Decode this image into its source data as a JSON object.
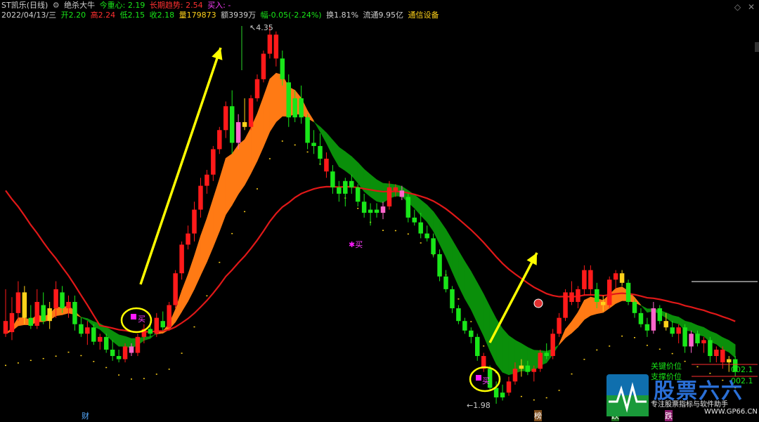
{
  "header": {
    "stock_name": "ST凯乐(日线)",
    "indicator_name": "绝杀大牛",
    "today_center_label": "今重心:",
    "today_center_value": "2.19",
    "long_trend_label": "长期趋势:",
    "long_trend_value": "2.54",
    "buy_in_label": "买入:",
    "buy_in_value": "-",
    "date": "2022/04/13/三",
    "open_label": "开",
    "open": "2.20",
    "high_label": "高",
    "high": "2.24",
    "low_label": "低",
    "low": "2.15",
    "close_label": "收",
    "close": "2.18",
    "volume_label": "量",
    "volume": "179873",
    "amount_label": "额",
    "amount": "3939万",
    "change_label": "幅",
    "change": "-0.05(-2.24%)",
    "turnover_label": "换",
    "turnover": "1.81%",
    "float_label": "流通",
    "float_cap": "9.95亿",
    "sector": "通信设备"
  },
  "icons": {
    "settings": "gear-icon",
    "expand": "diamond-icon",
    "close": "close-icon"
  },
  "annotations": {
    "high_price": "4.35",
    "low_price": "1.98",
    "buy_label": "买",
    "key_price_label": "关键价位",
    "support_label": "支撑价位",
    "key_price_value": "002.1",
    "support_value": "002.1",
    "bottom_markers": [
      "财",
      "榜",
      "跌",
      "跌"
    ]
  },
  "logo": {
    "title": "股票六六",
    "subtitle": "专注股票指标与软件助手",
    "site": "WWW.GP66.CN"
  },
  "colors": {
    "up": "#ff1a1a",
    "down": "#19e619",
    "yellow": "#ffd21a",
    "pink": "#ff66cc",
    "green_band": "#0a8f0a",
    "orange_band": "#ff7a14",
    "ma_red": "#e01818",
    "arrow": "#ffff00",
    "circle": "#ffff00",
    "buy_marker": "#ff1aff"
  },
  "chart_data": {
    "type": "candlestick",
    "price_range": [
      1.98,
      4.35
    ],
    "candles": [
      {
        "o": 2.5,
        "h": 2.7,
        "l": 2.4,
        "c": 2.42,
        "col": "up"
      },
      {
        "o": 2.43,
        "h": 2.65,
        "l": 2.38,
        "c": 2.55,
        "col": "up"
      },
      {
        "o": 2.55,
        "h": 2.75,
        "l": 2.5,
        "c": 2.68,
        "col": "up"
      },
      {
        "o": 2.68,
        "h": 2.72,
        "l": 2.48,
        "c": 2.52,
        "col": "yellow"
      },
      {
        "o": 2.52,
        "h": 2.6,
        "l": 2.45,
        "c": 2.47,
        "col": "down"
      },
      {
        "o": 2.47,
        "h": 2.7,
        "l": 2.45,
        "c": 2.62,
        "col": "up"
      },
      {
        "o": 2.6,
        "h": 2.68,
        "l": 2.48,
        "c": 2.5,
        "col": "down"
      },
      {
        "o": 2.5,
        "h": 2.62,
        "l": 2.45,
        "c": 2.58,
        "col": "yellow"
      },
      {
        "o": 2.58,
        "h": 2.75,
        "l": 2.52,
        "c": 2.7,
        "col": "up"
      },
      {
        "o": 2.68,
        "h": 2.72,
        "l": 2.55,
        "c": 2.58,
        "col": "down"
      },
      {
        "o": 2.58,
        "h": 2.66,
        "l": 2.52,
        "c": 2.62,
        "col": "up"
      },
      {
        "o": 2.62,
        "h": 2.66,
        "l": 2.44,
        "c": 2.48,
        "col": "down"
      },
      {
        "o": 2.48,
        "h": 2.52,
        "l": 2.4,
        "c": 2.42,
        "col": "down"
      },
      {
        "o": 2.42,
        "h": 2.5,
        "l": 2.35,
        "c": 2.46,
        "col": "up"
      },
      {
        "o": 2.46,
        "h": 2.48,
        "l": 2.35,
        "c": 2.37,
        "col": "down"
      },
      {
        "o": 2.37,
        "h": 2.42,
        "l": 2.32,
        "c": 2.4,
        "col": "up"
      },
      {
        "o": 2.4,
        "h": 2.42,
        "l": 2.3,
        "c": 2.32,
        "col": "down"
      },
      {
        "o": 2.32,
        "h": 2.38,
        "l": 2.25,
        "c": 2.28,
        "col": "down"
      },
      {
        "o": 2.28,
        "h": 2.32,
        "l": 2.24,
        "c": 2.26,
        "col": "down"
      },
      {
        "o": 2.26,
        "h": 2.36,
        "l": 2.24,
        "c": 2.34,
        "col": "up"
      },
      {
        "o": 2.34,
        "h": 2.36,
        "l": 2.28,
        "c": 2.3,
        "col": "pink"
      },
      {
        "o": 2.3,
        "h": 2.42,
        "l": 2.28,
        "c": 2.4,
        "col": "up"
      },
      {
        "o": 2.4,
        "h": 2.48,
        "l": 2.36,
        "c": 2.45,
        "col": "up"
      },
      {
        "o": 2.45,
        "h": 2.5,
        "l": 2.4,
        "c": 2.42,
        "col": "down"
      },
      {
        "o": 2.42,
        "h": 2.55,
        "l": 2.4,
        "c": 2.52,
        "col": "up"
      },
      {
        "o": 2.5,
        "h": 2.56,
        "l": 2.44,
        "c": 2.46,
        "col": "down"
      },
      {
        "o": 2.46,
        "h": 2.62,
        "l": 2.44,
        "c": 2.6,
        "col": "up"
      },
      {
        "o": 2.6,
        "h": 2.82,
        "l": 2.58,
        "c": 2.8,
        "col": "up"
      },
      {
        "o": 2.8,
        "h": 3.0,
        "l": 2.76,
        "c": 2.98,
        "col": "up"
      },
      {
        "o": 2.98,
        "h": 3.1,
        "l": 2.95,
        "c": 3.05,
        "col": "up"
      },
      {
        "o": 3.05,
        "h": 3.25,
        "l": 3.0,
        "c": 3.2,
        "col": "up"
      },
      {
        "o": 3.2,
        "h": 3.4,
        "l": 3.15,
        "c": 3.35,
        "col": "up"
      },
      {
        "o": 3.35,
        "h": 3.45,
        "l": 3.3,
        "c": 3.42,
        "col": "up"
      },
      {
        "o": 3.42,
        "h": 3.6,
        "l": 3.38,
        "c": 3.58,
        "col": "up"
      },
      {
        "o": 3.58,
        "h": 3.72,
        "l": 3.55,
        "c": 3.7,
        "col": "up"
      },
      {
        "o": 3.7,
        "h": 3.88,
        "l": 3.65,
        "c": 3.85,
        "col": "up"
      },
      {
        "o": 3.85,
        "h": 3.95,
        "l": 3.55,
        "c": 3.62,
        "col": "down"
      },
      {
        "o": 3.62,
        "h": 3.8,
        "l": 3.58,
        "c": 3.75,
        "col": "pink"
      },
      {
        "o": 3.75,
        "h": 3.9,
        "l": 3.7,
        "c": 3.72,
        "col": "yellow"
      },
      {
        "o": 3.72,
        "h": 3.92,
        "l": 3.7,
        "c": 3.9,
        "col": "up"
      },
      {
        "o": 3.9,
        "h": 4.05,
        "l": 3.88,
        "c": 4.02,
        "col": "up"
      },
      {
        "o": 4.02,
        "h": 4.2,
        "l": 4.0,
        "c": 4.18,
        "col": "up"
      },
      {
        "o": 4.18,
        "h": 4.35,
        "l": 4.15,
        "c": 4.3,
        "col": "up"
      },
      {
        "o": 4.3,
        "h": 4.32,
        "l": 4.1,
        "c": 4.15,
        "col": "up"
      },
      {
        "o": 4.15,
        "h": 4.2,
        "l": 3.98,
        "c": 4.02,
        "col": "down"
      },
      {
        "o": 4.0,
        "h": 4.05,
        "l": 3.72,
        "c": 3.78,
        "col": "down"
      },
      {
        "o": 3.78,
        "h": 3.95,
        "l": 3.75,
        "c": 3.9,
        "col": "down"
      },
      {
        "o": 3.9,
        "h": 3.98,
        "l": 3.74,
        "c": 3.78,
        "col": "down"
      },
      {
        "o": 3.78,
        "h": 3.8,
        "l": 3.58,
        "c": 3.62,
        "col": "down"
      },
      {
        "o": 3.62,
        "h": 3.7,
        "l": 3.55,
        "c": 3.6,
        "col": "down"
      },
      {
        "o": 3.6,
        "h": 3.68,
        "l": 3.48,
        "c": 3.52,
        "col": "down"
      },
      {
        "o": 3.52,
        "h": 3.56,
        "l": 3.4,
        "c": 3.44,
        "col": "up"
      },
      {
        "o": 3.44,
        "h": 3.48,
        "l": 3.3,
        "c": 3.34,
        "col": "down"
      },
      {
        "o": 3.34,
        "h": 3.38,
        "l": 3.25,
        "c": 3.3,
        "col": "down"
      },
      {
        "o": 3.3,
        "h": 3.4,
        "l": 3.22,
        "c": 3.38,
        "col": "down"
      },
      {
        "o": 3.38,
        "h": 3.42,
        "l": 3.3,
        "c": 3.34,
        "col": "down"
      },
      {
        "o": 3.34,
        "h": 3.36,
        "l": 3.22,
        "c": 3.25,
        "col": "down"
      },
      {
        "o": 3.25,
        "h": 3.3,
        "l": 3.15,
        "c": 3.18,
        "col": "down"
      },
      {
        "o": 3.18,
        "h": 3.24,
        "l": 3.1,
        "c": 3.2,
        "col": "down"
      },
      {
        "o": 3.2,
        "h": 3.24,
        "l": 3.15,
        "c": 3.18,
        "col": "down"
      },
      {
        "o": 3.18,
        "h": 3.25,
        "l": 3.14,
        "c": 3.22,
        "col": "pink"
      },
      {
        "o": 3.22,
        "h": 3.38,
        "l": 3.2,
        "c": 3.34,
        "col": "up"
      },
      {
        "o": 3.34,
        "h": 3.36,
        "l": 3.28,
        "c": 3.32,
        "col": "up"
      },
      {
        "o": 3.32,
        "h": 3.35,
        "l": 3.26,
        "c": 3.28,
        "col": "pink"
      },
      {
        "o": 3.28,
        "h": 3.3,
        "l": 3.12,
        "c": 3.15,
        "col": "down"
      },
      {
        "o": 3.15,
        "h": 3.2,
        "l": 3.1,
        "c": 3.12,
        "col": "down"
      },
      {
        "o": 3.12,
        "h": 3.18,
        "l": 3.02,
        "c": 3.05,
        "col": "down"
      },
      {
        "o": 3.05,
        "h": 3.1,
        "l": 3.0,
        "c": 3.02,
        "col": "down"
      },
      {
        "o": 3.02,
        "h": 3.05,
        "l": 2.9,
        "c": 2.92,
        "col": "down"
      },
      {
        "o": 2.92,
        "h": 2.95,
        "l": 2.75,
        "c": 2.78,
        "col": "down"
      },
      {
        "o": 2.78,
        "h": 2.82,
        "l": 2.68,
        "c": 2.7,
        "col": "down"
      },
      {
        "o": 2.7,
        "h": 2.72,
        "l": 2.55,
        "c": 2.58,
        "col": "down"
      },
      {
        "o": 2.58,
        "h": 2.6,
        "l": 2.48,
        "c": 2.5,
        "col": "down"
      },
      {
        "o": 2.5,
        "h": 2.52,
        "l": 2.42,
        "c": 2.44,
        "col": "down"
      },
      {
        "o": 2.44,
        "h": 2.46,
        "l": 2.36,
        "c": 2.4,
        "col": "down"
      },
      {
        "o": 2.4,
        "h": 2.42,
        "l": 2.25,
        "c": 2.28,
        "col": "down"
      },
      {
        "o": 2.28,
        "h": 2.3,
        "l": 2.18,
        "c": 2.2,
        "col": "up"
      },
      {
        "o": 2.2,
        "h": 2.22,
        "l": 2.06,
        "c": 2.08,
        "col": "down"
      },
      {
        "o": 2.08,
        "h": 2.12,
        "l": 1.98,
        "c": 2.02,
        "col": "down"
      },
      {
        "o": 2.02,
        "h": 2.1,
        "l": 2.0,
        "c": 2.05,
        "col": "down"
      },
      {
        "o": 2.05,
        "h": 2.15,
        "l": 2.03,
        "c": 2.12,
        "col": "up"
      },
      {
        "o": 2.12,
        "h": 2.24,
        "l": 2.1,
        "c": 2.2,
        "col": "up"
      },
      {
        "o": 2.2,
        "h": 2.26,
        "l": 2.15,
        "c": 2.22,
        "col": "yellow"
      },
      {
        "o": 2.22,
        "h": 2.25,
        "l": 2.16,
        "c": 2.18,
        "col": "down"
      },
      {
        "o": 2.18,
        "h": 2.22,
        "l": 2.12,
        "c": 2.2,
        "col": "up"
      },
      {
        "o": 2.2,
        "h": 2.32,
        "l": 2.18,
        "c": 2.3,
        "col": "up"
      },
      {
        "o": 2.3,
        "h": 2.36,
        "l": 2.26,
        "c": 2.28,
        "col": "down"
      },
      {
        "o": 2.28,
        "h": 2.45,
        "l": 2.26,
        "c": 2.42,
        "col": "up"
      },
      {
        "o": 2.42,
        "h": 2.55,
        "l": 2.4,
        "c": 2.52,
        "col": "up"
      },
      {
        "o": 2.52,
        "h": 2.7,
        "l": 2.5,
        "c": 2.68,
        "col": "up"
      },
      {
        "o": 2.68,
        "h": 2.75,
        "l": 2.6,
        "c": 2.62,
        "col": "up"
      },
      {
        "o": 2.62,
        "h": 2.72,
        "l": 2.58,
        "c": 2.7,
        "col": "up"
      },
      {
        "o": 2.7,
        "h": 2.85,
        "l": 2.66,
        "c": 2.82,
        "col": "up"
      },
      {
        "o": 2.82,
        "h": 2.85,
        "l": 2.66,
        "c": 2.7,
        "col": "up"
      },
      {
        "o": 2.7,
        "h": 2.74,
        "l": 2.58,
        "c": 2.62,
        "col": "down"
      },
      {
        "o": 2.62,
        "h": 2.66,
        "l": 2.56,
        "c": 2.6,
        "col": "yellow"
      },
      {
        "o": 2.6,
        "h": 2.78,
        "l": 2.58,
        "c": 2.76,
        "col": "up"
      },
      {
        "o": 2.76,
        "h": 2.82,
        "l": 2.7,
        "c": 2.8,
        "col": "up"
      },
      {
        "o": 2.8,
        "h": 2.82,
        "l": 2.72,
        "c": 2.74,
        "col": "yellow"
      },
      {
        "o": 2.74,
        "h": 2.76,
        "l": 2.6,
        "c": 2.62,
        "col": "down"
      },
      {
        "o": 2.62,
        "h": 2.64,
        "l": 2.52,
        "c": 2.55,
        "col": "down"
      },
      {
        "o": 2.55,
        "h": 2.58,
        "l": 2.46,
        "c": 2.48,
        "col": "down"
      },
      {
        "o": 2.48,
        "h": 2.52,
        "l": 2.4,
        "c": 2.44,
        "col": "down"
      },
      {
        "o": 2.44,
        "h": 2.62,
        "l": 2.42,
        "c": 2.58,
        "col": "pink"
      },
      {
        "o": 2.58,
        "h": 2.6,
        "l": 2.48,
        "c": 2.5,
        "col": "down"
      },
      {
        "o": 2.5,
        "h": 2.55,
        "l": 2.44,
        "c": 2.46,
        "col": "yellow"
      },
      {
        "o": 2.46,
        "h": 2.5,
        "l": 2.4,
        "c": 2.42,
        "col": "down"
      },
      {
        "o": 2.42,
        "h": 2.48,
        "l": 2.36,
        "c": 2.46,
        "col": "up"
      },
      {
        "o": 2.46,
        "h": 2.48,
        "l": 2.3,
        "c": 2.34,
        "col": "down"
      },
      {
        "o": 2.34,
        "h": 2.44,
        "l": 2.3,
        "c": 2.42,
        "col": "pink"
      },
      {
        "o": 2.42,
        "h": 2.44,
        "l": 2.34,
        "c": 2.36,
        "col": "down"
      },
      {
        "o": 2.36,
        "h": 2.4,
        "l": 2.3,
        "c": 2.38,
        "col": "up"
      },
      {
        "o": 2.38,
        "h": 2.4,
        "l": 2.24,
        "c": 2.28,
        "col": "down"
      },
      {
        "o": 2.28,
        "h": 2.34,
        "l": 2.24,
        "c": 2.32,
        "col": "up"
      },
      {
        "o": 2.32,
        "h": 2.34,
        "l": 2.2,
        "c": 2.24,
        "col": "up"
      },
      {
        "o": 2.24,
        "h": 2.28,
        "l": 2.18,
        "c": 2.26,
        "col": "yellow"
      },
      {
        "o": 2.26,
        "h": 2.28,
        "l": 2.15,
        "c": 2.18,
        "col": "down"
      }
    ]
  }
}
